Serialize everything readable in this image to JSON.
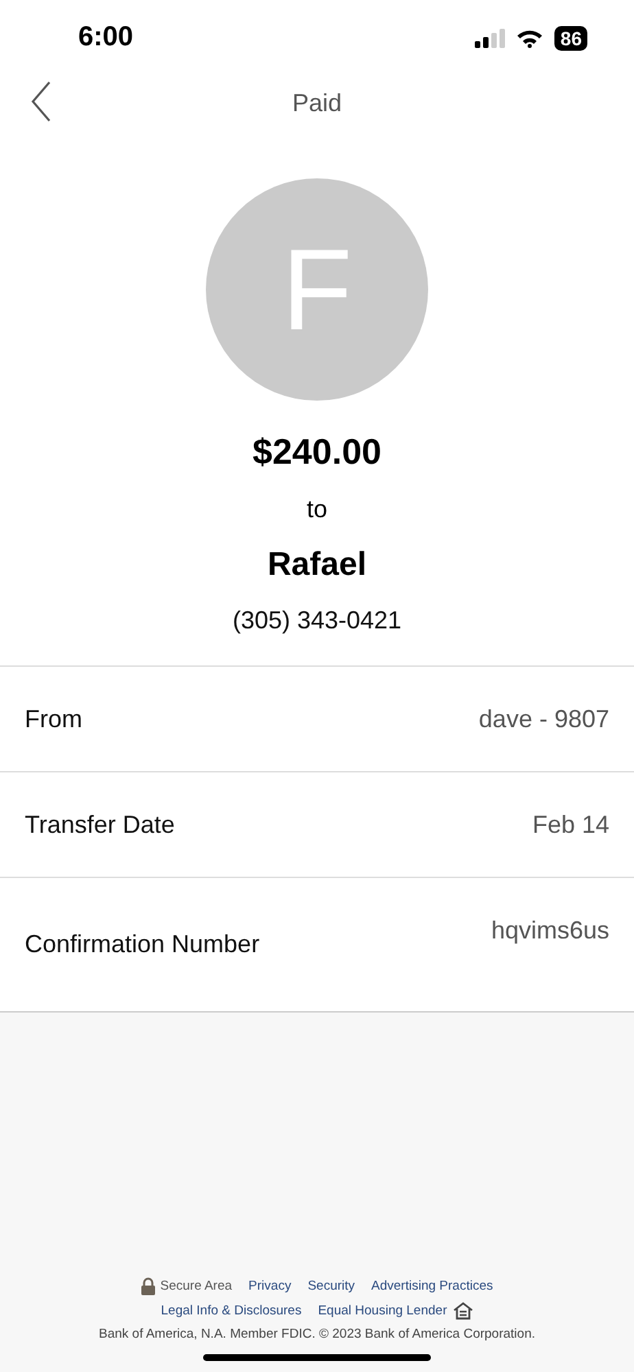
{
  "status_bar": {
    "time": "6:00",
    "battery": "86"
  },
  "nav": {
    "title": "Paid"
  },
  "recipient": {
    "initial": "F",
    "amount": "$240.00",
    "to": "to",
    "name": "Rafael",
    "phone": "(305) 343-0421"
  },
  "details": [
    {
      "label": "From",
      "value": "dave - 9807",
      "kind": "center"
    },
    {
      "label": "Transfer Date",
      "value": "Feb 14",
      "kind": "center"
    },
    {
      "label": "Confirmation Number",
      "value": "hqvims6us",
      "kind": "top"
    }
  ],
  "footer": {
    "secure": "Secure Area",
    "links_1": [
      "Privacy",
      "Security",
      "Advertising Practices"
    ],
    "links_2": [
      "Legal Info & Disclosures",
      "Equal Housing Lender"
    ],
    "legal": "Bank of America, N.A. Member FDIC. © 2023 Bank of America Corporation."
  }
}
